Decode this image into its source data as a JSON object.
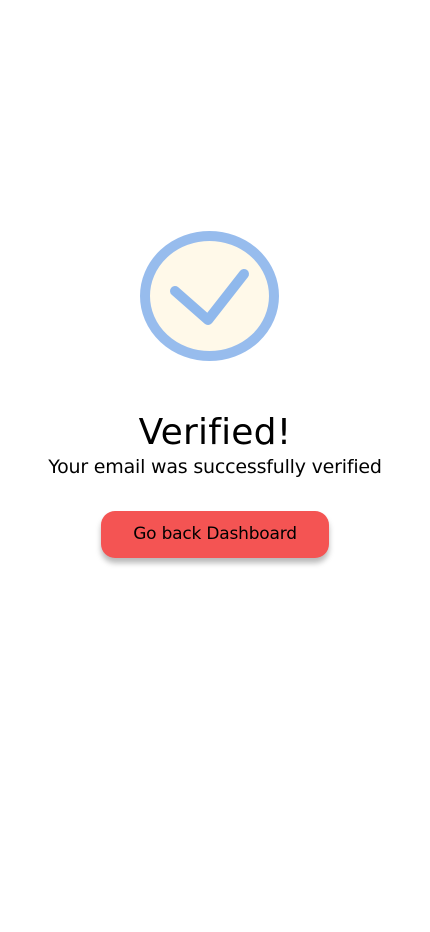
{
  "success": {
    "icon": "check-circle-icon",
    "title": "Verified!",
    "message": "Your email was successfully verified"
  },
  "actions": {
    "primary_label": "Go back Dashboard"
  },
  "colors": {
    "background": "#ffffff",
    "check_ring": "#97bced",
    "check_fill": "#fff9e9",
    "check_mark": "#8fb8ec",
    "button_bg": "#f45453",
    "text": "#000000"
  }
}
